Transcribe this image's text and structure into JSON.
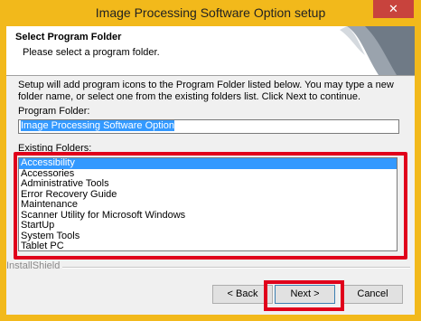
{
  "window": {
    "title": "Image Processing Software Option setup",
    "close_glyph": "✕",
    "accent_color": "#f2b91b"
  },
  "header": {
    "title": "Select Program Folder",
    "subtitle": "Please select a program folder."
  },
  "description": "Setup will add program icons to the Program Folder listed below.  You may type a new folder name, or select one from the existing folders list.  Click Next to continue.",
  "program_folder": {
    "label": "Program Folder:",
    "value": "Image Processing Software Option"
  },
  "existing_folders": {
    "label": "Existing Folders:",
    "items": [
      "Accessibility",
      "Accessories",
      "Administrative Tools",
      "Error Recovery Guide",
      "Maintenance",
      "Scanner Utility for Microsoft Windows",
      "StartUp",
      "System Tools",
      "Tablet PC"
    ],
    "selected": "Accessibility"
  },
  "footer": {
    "brand": "InstallShield"
  },
  "buttons": {
    "back": "< Back",
    "next": "Next >",
    "cancel": "Cancel"
  },
  "highlight_color": "#e0001b"
}
